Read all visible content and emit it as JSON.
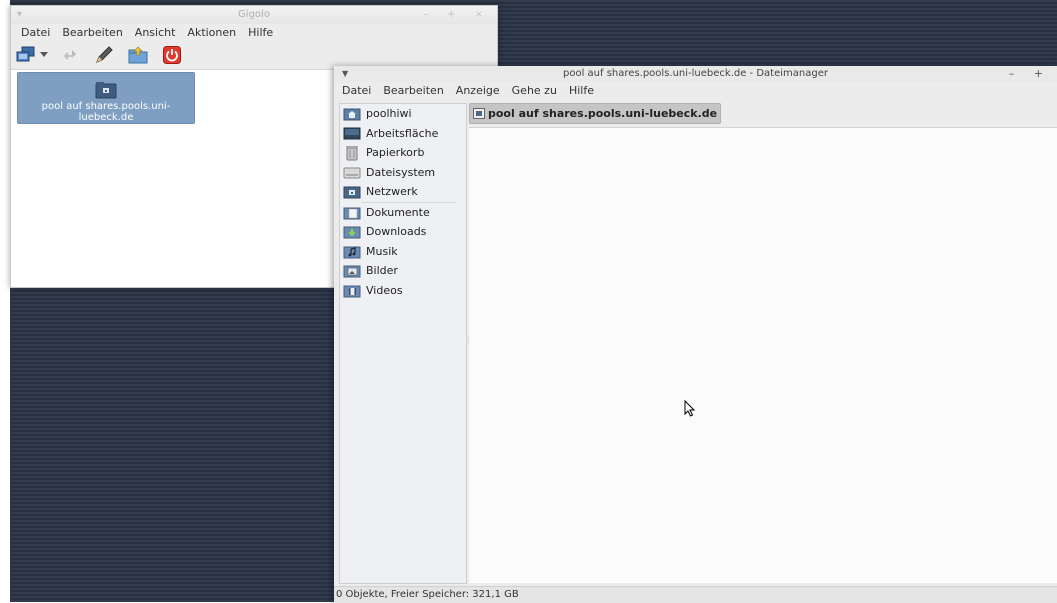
{
  "gigolo": {
    "title": "Gigolo",
    "window_buttons": "– + ×",
    "menu": [
      "Datei",
      "Bearbeiten",
      "Ansicht",
      "Aktionen",
      "Hilfe"
    ],
    "toolbar_icons": [
      "connect-icon",
      "dropdown-arrow-icon",
      "disconnect-icon",
      "edit-bookmark-icon",
      "open-folder-icon",
      "quit-icon"
    ],
    "bookmark": {
      "label": "pool auf shares.pools.uni-luebeck.de",
      "icon": "network-drive-icon"
    }
  },
  "file_manager": {
    "title": "pool auf shares.pools.uni-luebeck.de - Dateimanager",
    "window_buttons": "– +",
    "menu": [
      "Datei",
      "Bearbeiten",
      "Anzeige",
      "Gehe zu",
      "Hilfe"
    ],
    "sidebar": {
      "places": [
        {
          "label": "poolhiwi",
          "icon": "home-folder-icon"
        },
        {
          "label": "Arbeitsfläche",
          "icon": "desktop-icon"
        },
        {
          "label": "Papierkorb",
          "icon": "trash-icon"
        },
        {
          "label": "Dateisystem",
          "icon": "harddisk-icon"
        },
        {
          "label": "Netzwerk",
          "icon": "network-icon"
        }
      ],
      "bookmarks": [
        {
          "label": "Dokumente",
          "icon": "documents-folder-icon"
        },
        {
          "label": "Downloads",
          "icon": "downloads-folder-icon"
        },
        {
          "label": "Musik",
          "icon": "music-folder-icon"
        },
        {
          "label": "Bilder",
          "icon": "pictures-folder-icon"
        },
        {
          "label": "Videos",
          "icon": "videos-folder-icon"
        }
      ]
    },
    "pathbar": {
      "label": "pool auf shares.pools.uni-luebeck.de",
      "icon": "network-drive-icon"
    },
    "status": "0 Objekte, Freier Speicher: 321,1 GB"
  }
}
